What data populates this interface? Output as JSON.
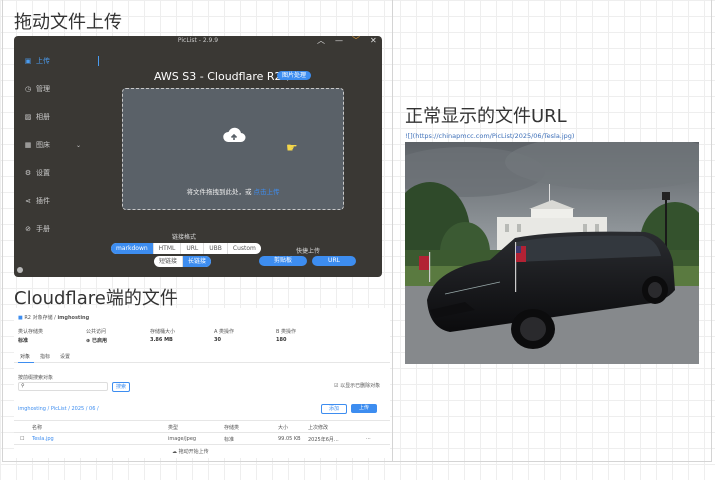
{
  "headings": {
    "drag_upload": "拖动文件上传",
    "cloudflare_files": "Cloudflare端的文件",
    "normal_url": "正常显示的文件URL"
  },
  "piclist": {
    "title": "PicList - 2.9.9",
    "window_controls": [
      "chevron-up-icon",
      "minimize-icon",
      "chevron-down-icon",
      "close-icon"
    ],
    "nav": [
      {
        "label": "上传",
        "icon": "upload-icon",
        "active": true
      },
      {
        "label": "管理",
        "icon": "clock-icon",
        "active": false
      },
      {
        "label": "相册",
        "icon": "image-icon",
        "active": false
      },
      {
        "label": "图床",
        "icon": "grid-icon",
        "active": false
      },
      {
        "label": "设置",
        "icon": "gear-icon",
        "active": false
      },
      {
        "label": "插件",
        "icon": "share-icon",
        "active": false
      },
      {
        "label": "手册",
        "icon": "link-icon",
        "active": false
      }
    ],
    "bed_name": "AWS S3 - Cloudflare R2",
    "bed_badge": "图片处理",
    "drop_text": "将文件拖拽到此处，或",
    "drop_link": "点击上传",
    "link_format_label": "链接格式",
    "formats": [
      "markdown",
      "HTML",
      "URL",
      "UBB",
      "Custom"
    ],
    "selected_format": "markdown",
    "link_type": [
      "短链接",
      "长链接"
    ],
    "selected_link_type": "长链接",
    "quick_upload_label": "快捷上传",
    "quick_buttons": [
      "剪贴板",
      "URL"
    ],
    "accent": "#3d8df0"
  },
  "cloudflare": {
    "breadcrumb_root": "R2 对象存储",
    "bucket": "imghosting",
    "stats": [
      {
        "label": "类认存储类",
        "value": "标准"
      },
      {
        "label": "公共访问",
        "value": "已启用"
      },
      {
        "label": "存储桶大小",
        "value": "3.86 MB"
      },
      {
        "label": "A 类操作",
        "value": "30"
      },
      {
        "label": "B 类操作",
        "value": "180"
      }
    ],
    "tabs": [
      "对象",
      "指标",
      "设置"
    ],
    "search_label": "按前缀搜索对象",
    "search_button": "搜索",
    "checkbox_label": "以显示已删除对象",
    "path": "imghosting / PicList / 2025 / 06 /",
    "btn_folder": "添加",
    "btn_upload": "上传",
    "columns": [
      "名称",
      "类型",
      "存储类",
      "大小",
      "上次修改"
    ],
    "files": [
      {
        "name": "Tesla.jpg",
        "type": "image/jpeg",
        "class": "标准",
        "size": "99.05 KB",
        "modified": "2025年6月..."
      }
    ],
    "footer": "拖动开始上传"
  },
  "right": {
    "url": "![](https://chinapmcc.com/PicList/2025/06/Tesla.jpg)"
  }
}
